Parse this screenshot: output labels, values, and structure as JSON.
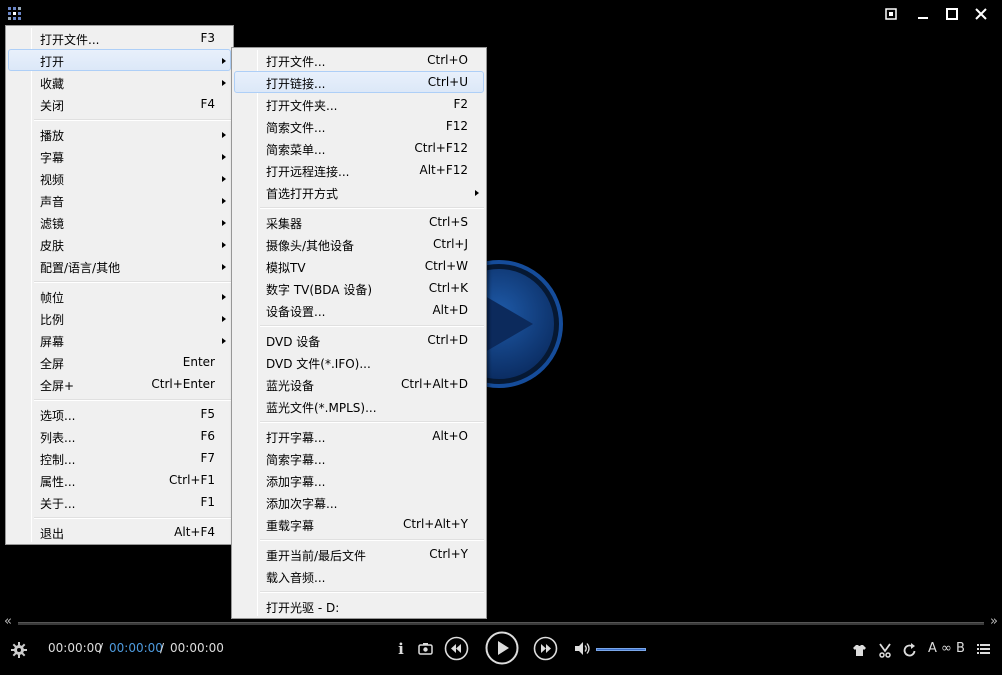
{
  "colors": {
    "background": "#000000",
    "menu_bg": "#f0f0f0",
    "highlight": "#dce8f8",
    "accent_blue": "#4e9bde"
  },
  "title_bar": {
    "icons": [
      "app-menu-icon",
      "fullscreen-toggle-icon",
      "minimize-icon",
      "maximize-icon",
      "close-icon"
    ]
  },
  "main_menu": {
    "items": [
      {
        "label": "打开文件...",
        "shortcut": "F3"
      },
      {
        "label": "打开",
        "submenu": true,
        "highlighted": true
      },
      {
        "label": "收藏",
        "submenu": true
      },
      {
        "label": "关闭",
        "shortcut": "F4"
      },
      {
        "label": "播放",
        "submenu": true
      },
      {
        "label": "字幕",
        "submenu": true
      },
      {
        "label": "视频",
        "submenu": true
      },
      {
        "label": "声音",
        "submenu": true
      },
      {
        "label": "滤镜",
        "submenu": true
      },
      {
        "label": "皮肤",
        "submenu": true
      },
      {
        "label": "配置/语言/其他",
        "submenu": true
      },
      {
        "label": "帧位",
        "submenu": true
      },
      {
        "label": "比例",
        "submenu": true
      },
      {
        "label": "屏幕",
        "submenu": true
      },
      {
        "label": "全屏",
        "shortcut": "Enter"
      },
      {
        "label": "全屏+",
        "shortcut": "Ctrl+Enter"
      },
      {
        "label": "选项...",
        "shortcut": "F5"
      },
      {
        "label": "列表...",
        "shortcut": "F6"
      },
      {
        "label": "控制...",
        "shortcut": "F7"
      },
      {
        "label": "属性...",
        "shortcut": "Ctrl+F1"
      },
      {
        "label": "关于...",
        "shortcut": "F1"
      },
      {
        "label": "退出",
        "shortcut": "Alt+F4"
      }
    ]
  },
  "open_submenu": {
    "items": [
      {
        "label": "打开文件...",
        "shortcut": "Ctrl+O"
      },
      {
        "label": "打开链接...",
        "shortcut": "Ctrl+U",
        "highlighted": true
      },
      {
        "label": "打开文件夹...",
        "shortcut": "F2"
      },
      {
        "label": "简索文件...",
        "shortcut": "F12"
      },
      {
        "label": "简索菜单...",
        "shortcut": "Ctrl+F12"
      },
      {
        "label": "打开远程连接...",
        "shortcut": "Alt+F12"
      },
      {
        "label": "首选打开方式",
        "submenu": true
      },
      {
        "label": "采集器",
        "shortcut": "Ctrl+S"
      },
      {
        "label": "摄像头/其他设备",
        "shortcut": "Ctrl+J"
      },
      {
        "label": "模拟TV",
        "shortcut": "Ctrl+W"
      },
      {
        "label": "数字 TV(BDA 设备)",
        "shortcut": "Ctrl+K"
      },
      {
        "label": "设备设置...",
        "shortcut": "Alt+D"
      },
      {
        "label": "DVD 设备",
        "shortcut": "Ctrl+D"
      },
      {
        "label": "DVD 文件(*.IFO)..."
      },
      {
        "label": "蓝光设备",
        "shortcut": "Ctrl+Alt+D"
      },
      {
        "label": "蓝光文件(*.MPLS)..."
      },
      {
        "label": "打开字幕...",
        "shortcut": "Alt+O"
      },
      {
        "label": "简索字幕..."
      },
      {
        "label": "添加字幕..."
      },
      {
        "label": "添加次字幕..."
      },
      {
        "label": "重载字幕",
        "shortcut": "Ctrl+Alt+Y"
      },
      {
        "label": "重开当前/最后文件",
        "shortcut": "Ctrl+Y"
      },
      {
        "label": "载入音频..."
      },
      {
        "label": "打开光驱 - D:"
      }
    ]
  },
  "controls": {
    "seek_left": "«",
    "seek_right": "»",
    "time_current": "00:00:00",
    "time_sep1": " / ",
    "time_ab": "00:00:00",
    "time_sep2": " / ",
    "time_total": "00:00:00",
    "info_label": "i",
    "ab_label": "A ∞ B",
    "volume_fraction": 1.0,
    "icons": [
      "settings-gear-icon",
      "info-icon",
      "screenshot-icon",
      "previous-icon",
      "play-icon",
      "next-icon",
      "volume-icon",
      "skin-shirt-icon",
      "trim-icon",
      "repeat-icon",
      "ab-repeat-icon",
      "playlist-icon"
    ]
  }
}
